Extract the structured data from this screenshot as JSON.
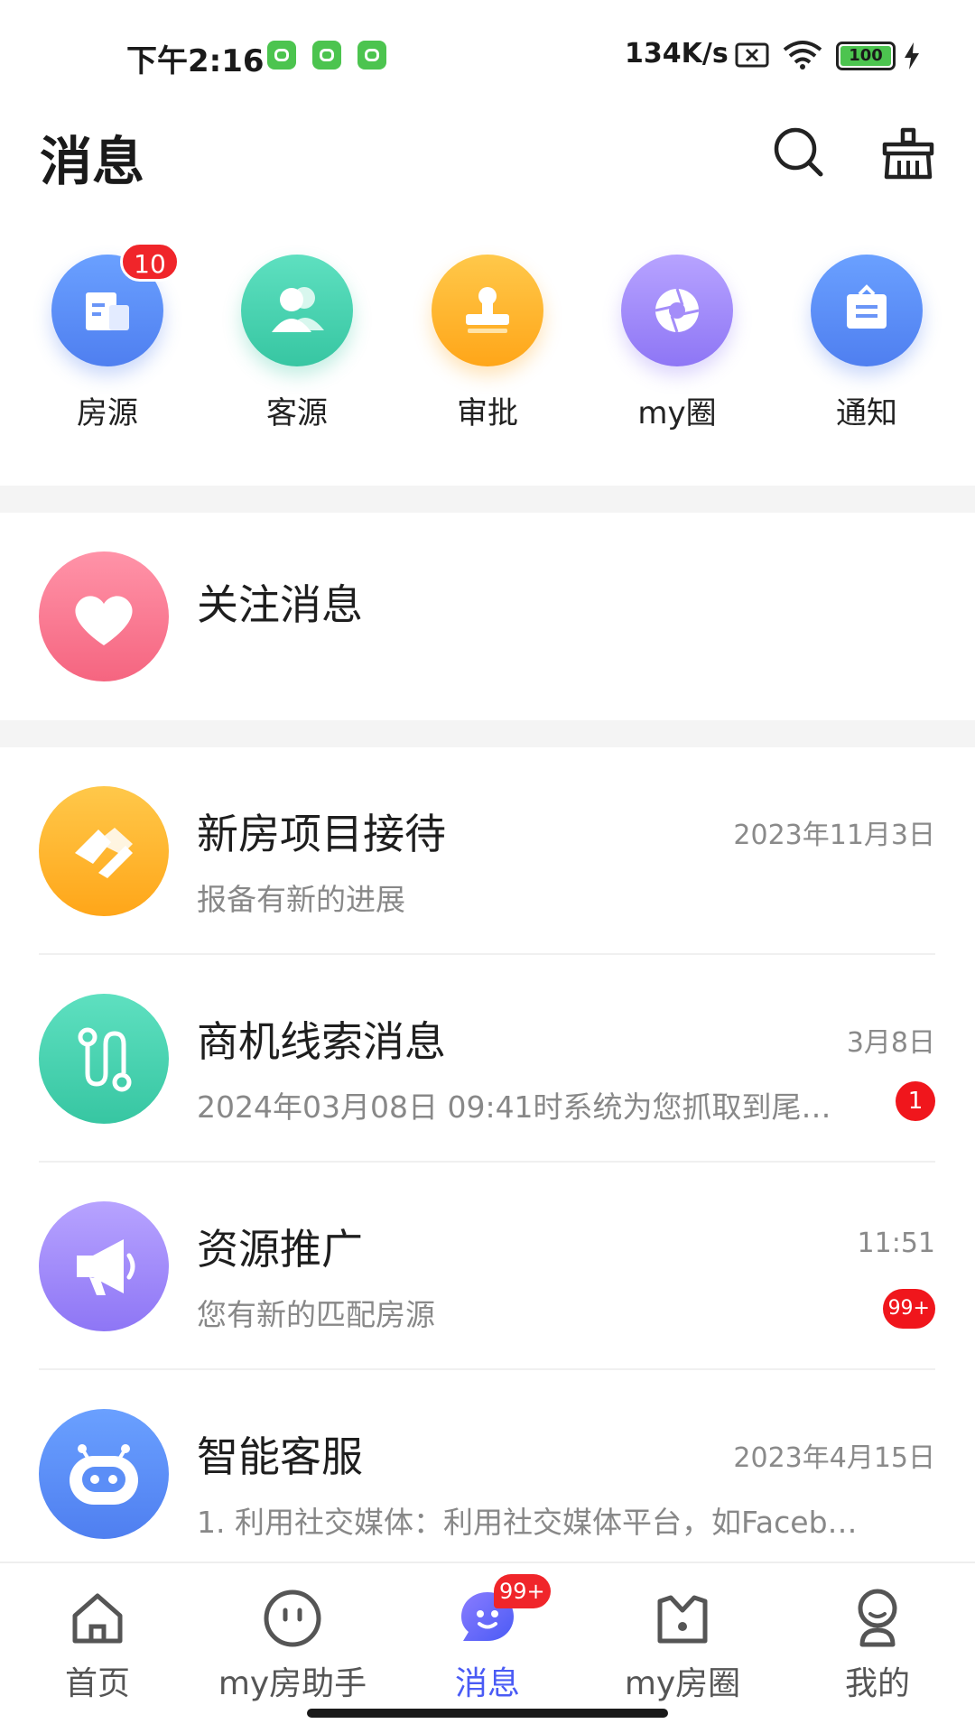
{
  "status_bar": {
    "time": "下午2:16",
    "network_speed": "134K/s",
    "battery": "100",
    "icons": [
      "app-icon",
      "app-icon",
      "app-icon",
      "no-sim-icon",
      "wifi-icon",
      "battery-icon",
      "charging-icon"
    ]
  },
  "header": {
    "title": "消息",
    "icons": [
      "search-icon",
      "clean-brush-icon"
    ]
  },
  "quick_entries": [
    {
      "label": "房源",
      "badge": "10",
      "icon": "building-icon",
      "color": "#5b8ef7"
    },
    {
      "label": "客源",
      "icon": "people-icon",
      "color": "#3fcfad"
    },
    {
      "label": "审批",
      "icon": "stamp-icon",
      "color": "#ffb22e"
    },
    {
      "label": "my圈",
      "icon": "aperture-icon",
      "color": "#9e86f7"
    },
    {
      "label": "通知",
      "icon": "notice-board-icon",
      "color": "#5b8ef7"
    }
  ],
  "follow": {
    "title": "关注消息",
    "icon": "heart-icon"
  },
  "messages": [
    {
      "title": "新房项目接待",
      "time": "2023年11月3日",
      "preview": "报备有新的进展",
      "badge": "",
      "icon": "handshake-icon"
    },
    {
      "title": "商机线索消息",
      "time": "3月8日",
      "preview": "2024年03月08日 09:41时系统为您抓取到尾…",
      "badge": "1",
      "icon": "route-icon"
    },
    {
      "title": "资源推广",
      "time": "11:51",
      "preview": "您有新的匹配房源",
      "badge": "99+",
      "icon": "megaphone-icon"
    },
    {
      "title": "智能客服",
      "time": "2023年4月15日",
      "preview": " 1. 利用社交媒体：利用社交媒体平台，如Faceb…",
      "badge": "",
      "icon": "robot-icon"
    }
  ],
  "bottom_nav": [
    {
      "label": "首页",
      "icon": "home-icon",
      "active": false
    },
    {
      "label": "my房助手",
      "icon": "assistant-face-icon",
      "active": false
    },
    {
      "label": "消息",
      "icon": "message-bubble-icon",
      "active": true,
      "badge": "99+"
    },
    {
      "label": "my房圈",
      "icon": "circle-m-icon",
      "active": false
    },
    {
      "label": "我的",
      "icon": "user-icon",
      "active": false
    }
  ],
  "colors": {
    "accent": "#4a5bf5",
    "badge_red": "#f0252a",
    "separator": "#f4f4f4"
  }
}
